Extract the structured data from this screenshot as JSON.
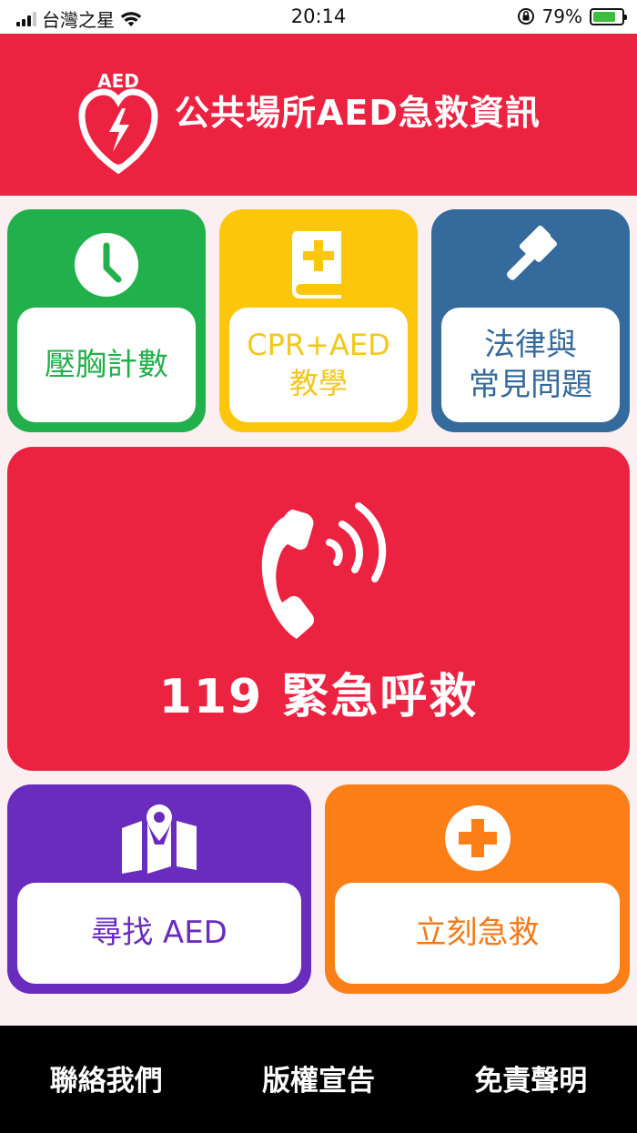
{
  "status_bar": {
    "carrier": "台灣之星",
    "time": "20:14",
    "battery": "79%",
    "battery_level": 0.79
  },
  "header": {
    "logo_text": "AED",
    "title": "公共場所AED急救資訊"
  },
  "tiles": {
    "compression": {
      "label": "壓胸計數",
      "icon": "clock-icon",
      "color": "#21b04b"
    },
    "cpr": {
      "label": "CPR+AED\n教學",
      "icon": "medical-book-icon",
      "color": "#fcc70a"
    },
    "law": {
      "label": "法律與\n常見問題",
      "icon": "gavel-icon",
      "color": "#356a9c"
    },
    "emergency": {
      "label": "119 緊急呼救",
      "icon": "phone-call-icon",
      "color": "#ec2241"
    },
    "find_aed": {
      "label": "尋找 AED",
      "icon": "map-pin-icon",
      "color": "#6a2bbf"
    },
    "first_aid": {
      "label": "立刻急救",
      "icon": "plus-circle-icon",
      "color": "#fb7f16"
    }
  },
  "footer": {
    "contact": "聯絡我們",
    "copyright": "版權宣告",
    "disclaimer": "免責聲明"
  }
}
